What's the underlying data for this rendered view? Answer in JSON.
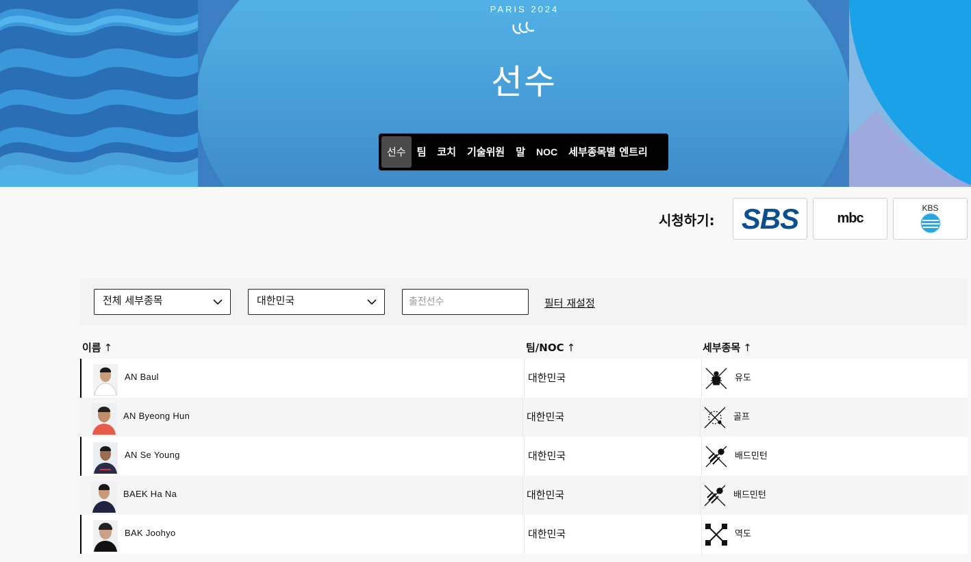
{
  "hero": {
    "logo_text": "PARIS 2024",
    "title": "선수"
  },
  "nav": {
    "items": [
      {
        "label": "선수",
        "active": true
      },
      {
        "label": "팀"
      },
      {
        "label": "코치"
      },
      {
        "label": "기술위원"
      },
      {
        "label": "말"
      },
      {
        "label": "NOC"
      },
      {
        "label": "세부종목별 엔트리"
      }
    ]
  },
  "broadcast": {
    "label": "시청하기:",
    "channels": [
      "SBS",
      "mbc",
      "KBS"
    ]
  },
  "filters": {
    "sport_select": "전체 세부종목",
    "noc_select": "대한민국",
    "search_placeholder": "출전선수",
    "reset_label": "필터 재설정"
  },
  "table": {
    "headers": {
      "name": "이름",
      "noc": "팀/NOC",
      "discipline": "세부종목"
    },
    "sort_arrow": "↑",
    "rows": [
      {
        "name": "AN Baul",
        "noc": "대한민국",
        "discipline": "유도",
        "icon": "judo-icon"
      },
      {
        "name": "AN Byeong Hun",
        "noc": "대한민국",
        "discipline": "골프",
        "icon": "golf-icon"
      },
      {
        "name": "AN Se Young",
        "noc": "대한민국",
        "discipline": "배드민턴",
        "icon": "badminton-icon"
      },
      {
        "name": "BAEK Ha Na",
        "noc": "대한민국",
        "discipline": "배드민턴",
        "icon": "badminton-icon"
      },
      {
        "name": "BAK Joohyo",
        "noc": "대한민국",
        "discipline": "역도",
        "icon": "weightlifting-icon"
      }
    ]
  },
  "colors": {
    "hero_blue": "#3d84c6",
    "nav_bg": "#000000",
    "sbs_blue": "#0a4f8f"
  }
}
